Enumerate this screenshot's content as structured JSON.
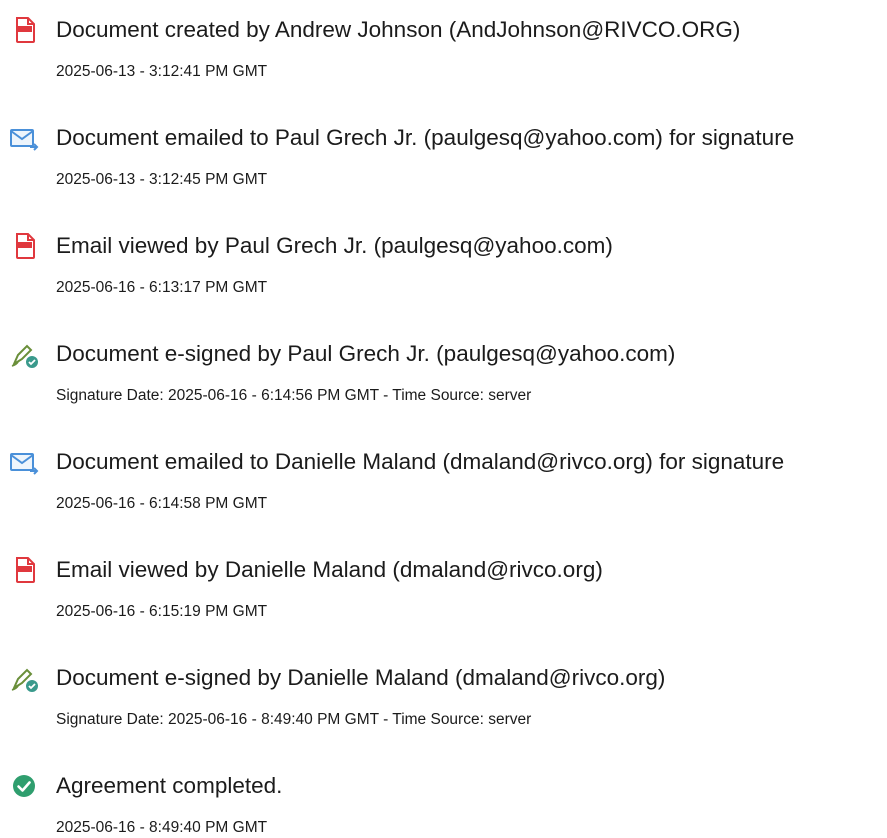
{
  "events": [
    {
      "icon": "document-created-icon",
      "title": "Document created by Andrew Johnson (AndJohnson@RIVCO.ORG)",
      "detail": "2025-06-13 - 3:12:41 PM GMT"
    },
    {
      "icon": "email-sent-icon",
      "title": "Document emailed to Paul Grech Jr. (paulgesq@yahoo.com) for signature",
      "detail": "2025-06-13 - 3:12:45 PM GMT"
    },
    {
      "icon": "email-viewed-icon",
      "title": "Email viewed by Paul Grech Jr. (paulgesq@yahoo.com)",
      "detail": "2025-06-16 - 6:13:17 PM GMT"
    },
    {
      "icon": "e-signature-icon",
      "title": "Document e-signed by Paul Grech Jr. (paulgesq@yahoo.com)",
      "detail": "Signature Date: 2025-06-16 - 6:14:56 PM GMT - Time Source: server"
    },
    {
      "icon": "email-sent-icon",
      "title": "Document emailed to Danielle Maland (dmaland@rivco.org) for signature",
      "detail": "2025-06-16 - 6:14:58 PM GMT"
    },
    {
      "icon": "email-viewed-icon",
      "title": "Email viewed by Danielle Maland (dmaland@rivco.org)",
      "detail": "2025-06-16 - 6:15:19 PM GMT"
    },
    {
      "icon": "e-signature-icon",
      "title": "Document e-signed by Danielle Maland (dmaland@rivco.org)",
      "detail": "Signature Date: 2025-06-16 - 8:49:40 PM GMT - Time Source: server"
    },
    {
      "icon": "completed-check-icon",
      "title": "Agreement completed.",
      "detail": "2025-06-16 - 8:49:40 PM GMT"
    }
  ],
  "colors": {
    "doc_icon": "#e0383e",
    "email_icon": "#4a90d9",
    "sign_icon": "#6a8f3a",
    "sign_badge": "#3a9a8c",
    "check_icon": "#2f9e6e"
  }
}
